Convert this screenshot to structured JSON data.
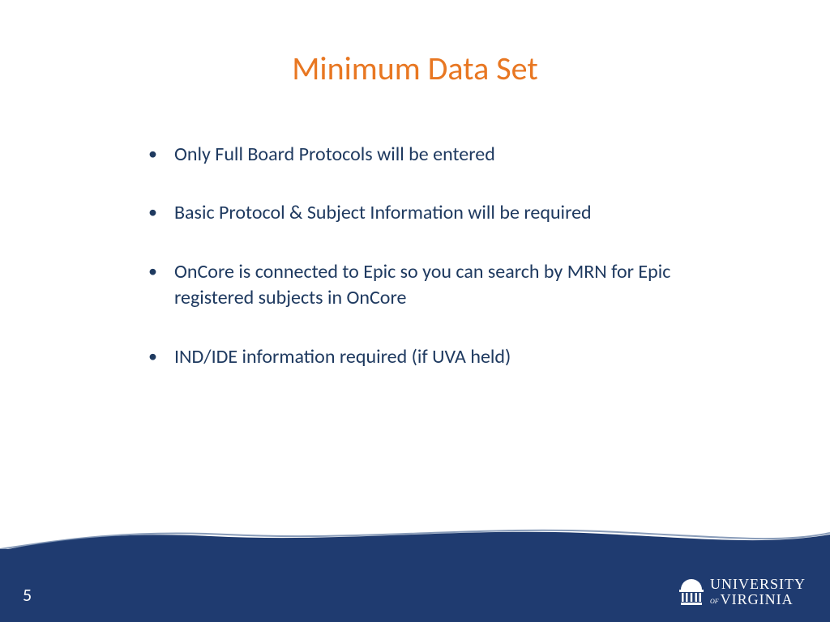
{
  "title": "Minimum Data Set",
  "bullets": [
    "Only Full Board Protocols will be entered",
    "Basic Protocol & Subject Information will be required",
    "OnCore is connected to Epic so you can search by MRN for Epic registered subjects in OnCore",
    "IND/IDE information required (if UVA held)"
  ],
  "page_number": "5",
  "logo": {
    "line1": "UNIVERSITY",
    "of": "of",
    "line2": "VIRGINIA"
  }
}
